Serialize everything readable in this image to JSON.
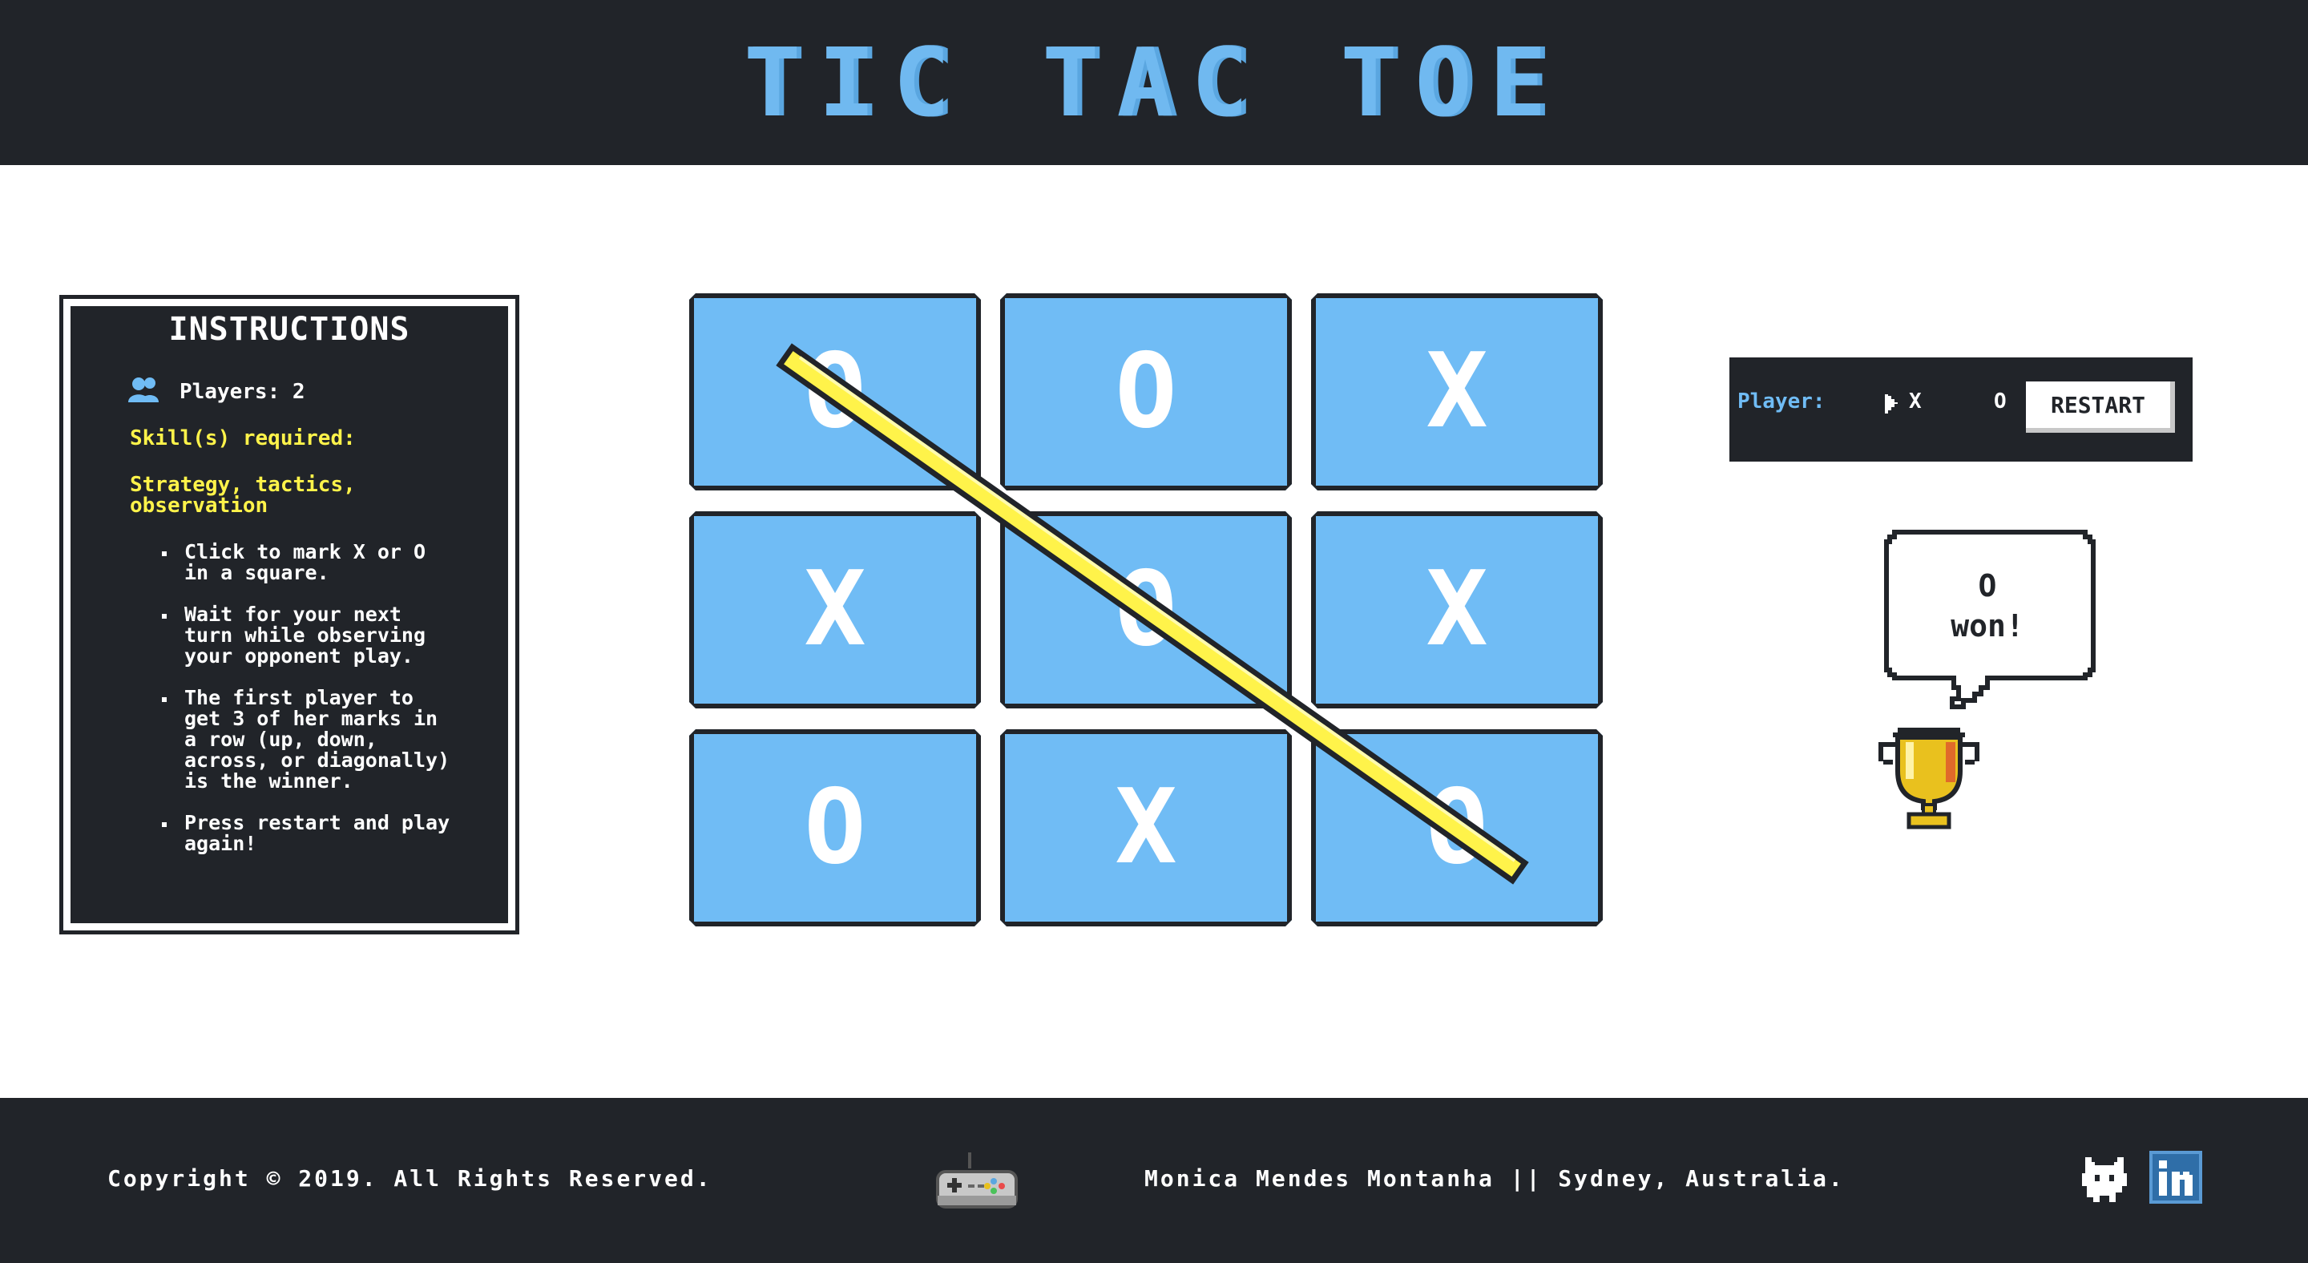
{
  "header": {
    "title": "TIC TAC TOE"
  },
  "instructions": {
    "title": "INSTRUCTIONS",
    "players": "Players: 2",
    "skills_label": "Skill(s) required:",
    "skills_line1": "Strategy, tactics,",
    "skills_line2": "observation",
    "rules": [
      "Click to mark X or O in a square.",
      "Wait for your next turn while observing your opponent play.",
      "The first player to get 3 of her marks in a row (up, down, across, or diagonally) is the winner.",
      "Press restart and play again!"
    ]
  },
  "board": {
    "cells": [
      "O",
      "O",
      "X",
      "X",
      "O",
      "X",
      "O",
      "X",
      "O"
    ],
    "winning_line": "diagonal-top-left-to-bottom-right",
    "line_color": "#fff34a",
    "cell_color": "#70bcf5"
  },
  "status": {
    "player_label": "Player:",
    "player_x": "X",
    "player_o": "O",
    "restart_label": "RESTART"
  },
  "result": {
    "message": "O\nwon!"
  },
  "footer": {
    "copyright": "Copyright © 2019. All Rights Reserved.",
    "author": "Monica Mendes Montanha || Sydney, Australia."
  },
  "icons": {
    "players": "users-icon",
    "arrow": "play-arrow-icon",
    "trophy": "trophy-icon",
    "gamepad": "gamepad-icon",
    "github": "github-icon",
    "linkedin": "linkedin-icon"
  },
  "colors": {
    "dark": "#212429",
    "accent_blue": "#70bcf5",
    "yellow": "#fff34a"
  }
}
